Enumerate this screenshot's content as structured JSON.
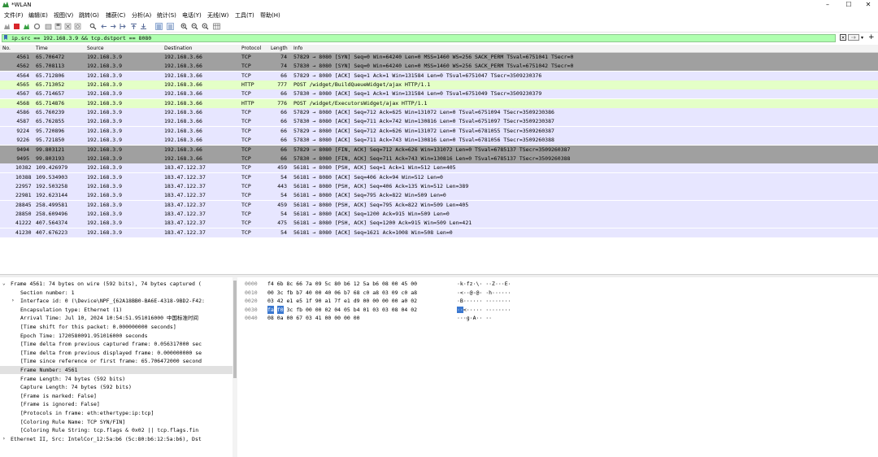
{
  "window": {
    "title": "*WLAN",
    "controls": [
      "–",
      "☐",
      "✕"
    ]
  },
  "menu": [
    "文件(F)",
    "编辑(E)",
    "视图(V)",
    "跳转(G)",
    "捕获(C)",
    "分析(A)",
    "统计(S)",
    "电话(Y)",
    "无线(W)",
    "工具(T)",
    "帮助(H)"
  ],
  "toolbar": {
    "icons": [
      "shark-fin-icon",
      "stop-icon",
      "restart-icon",
      "options-icon",
      "open-icon",
      "save-icon",
      "close-file-icon",
      "reload-icon",
      "find-icon",
      "back-icon",
      "forward-icon",
      "goto-icon",
      "first-icon",
      "last-icon",
      "autoscroll-icon",
      "colorize-icon",
      "zoom-in-icon",
      "zoom-out-icon",
      "zoom-normal-icon",
      "resize-columns-icon"
    ]
  },
  "filter": {
    "value": "ip.src == 192.168.3.9 && tcp.dstport == 8080",
    "add_symbol": "+"
  },
  "packet_list": {
    "columns": [
      "No.",
      "Time",
      "Source",
      "Destination",
      "Protocol",
      "Length",
      "Info"
    ],
    "rows": [
      {
        "no": "4561",
        "time": "65.706472",
        "src": "192.168.3.9",
        "dst": "192.168.3.66",
        "proto": "TCP",
        "len": "74",
        "info": "57829 → 8080 [SYN] Seq=0 Win=64240 Len=0 MSS=1460 WS=256 SACK_PERM TSval=6751041 TSecr=0",
        "style": "gray"
      },
      {
        "no": "4562",
        "time": "65.708113",
        "src": "192.168.3.9",
        "dst": "192.168.3.66",
        "proto": "TCP",
        "len": "74",
        "info": "57830 → 8080 [SYN] Seq=0 Win=64240 Len=0 MSS=1460 WS=256 SACK_PERM TSval=6751042 TSecr=0",
        "style": "gray"
      },
      {
        "no": "4564",
        "time": "65.712806",
        "src": "192.168.3.9",
        "dst": "192.168.3.66",
        "proto": "TCP",
        "len": "66",
        "info": "57829 → 8080 [ACK] Seq=1 Ack=1 Win=131584 Len=0 TSval=6751047 TSecr=3509230376",
        "style": "tcp"
      },
      {
        "no": "4565",
        "time": "65.713052",
        "src": "192.168.3.9",
        "dst": "192.168.3.66",
        "proto": "HTTP",
        "len": "777",
        "info": "POST /widget/BuildQueueWidget/ajax HTTP/1.1",
        "style": "http"
      },
      {
        "no": "4567",
        "time": "65.714657",
        "src": "192.168.3.9",
        "dst": "192.168.3.66",
        "proto": "TCP",
        "len": "66",
        "info": "57830 → 8080 [ACK] Seq=1 Ack=1 Win=131584 Len=0 TSval=6751049 TSecr=3509230379",
        "style": "tcp"
      },
      {
        "no": "4568",
        "time": "65.714876",
        "src": "192.168.3.9",
        "dst": "192.168.3.66",
        "proto": "HTTP",
        "len": "776",
        "info": "POST /widget/ExecutorsWidget/ajax HTTP/1.1",
        "style": "http"
      },
      {
        "no": "4586",
        "time": "65.760239",
        "src": "192.168.3.9",
        "dst": "192.168.3.66",
        "proto": "TCP",
        "len": "66",
        "info": "57829 → 8080 [ACK] Seq=712 Ack=625 Win=131072 Len=0 TSval=6751094 TSecr=3509230386",
        "style": "tcp"
      },
      {
        "no": "4587",
        "time": "65.762855",
        "src": "192.168.3.9",
        "dst": "192.168.3.66",
        "proto": "TCP",
        "len": "66",
        "info": "57830 → 8080 [ACK] Seq=711 Ack=742 Win=130816 Len=0 TSval=6751097 TSecr=3509230387",
        "style": "tcp"
      },
      {
        "no": "9224",
        "time": "95.720896",
        "src": "192.168.3.9",
        "dst": "192.168.3.66",
        "proto": "TCP",
        "len": "66",
        "info": "57829 → 8080 [ACK] Seq=712 Ack=626 Win=131072 Len=0 TSval=6781055 TSecr=3509260387",
        "style": "tcp"
      },
      {
        "no": "9226",
        "time": "95.721850",
        "src": "192.168.3.9",
        "dst": "192.168.3.66",
        "proto": "TCP",
        "len": "66",
        "info": "57830 → 8080 [ACK] Seq=711 Ack=743 Win=130816 Len=0 TSval=6781056 TSecr=3509260388",
        "style": "tcp"
      },
      {
        "no": "9494",
        "time": "99.803121",
        "src": "192.168.3.9",
        "dst": "192.168.3.66",
        "proto": "TCP",
        "len": "66",
        "info": "57829 → 8080 [FIN, ACK] Seq=712 Ack=626 Win=131072 Len=0 TSval=6785137 TSecr=3509260387",
        "style": "gray"
      },
      {
        "no": "9495",
        "time": "99.803193",
        "src": "192.168.3.9",
        "dst": "192.168.3.66",
        "proto": "TCP",
        "len": "66",
        "info": "57830 → 8080 [FIN, ACK] Seq=711 Ack=743 Win=130816 Len=0 TSval=6785137 TSecr=3509260388",
        "style": "gray"
      },
      {
        "no": "10382",
        "time": "109.426979",
        "src": "192.168.3.9",
        "dst": "183.47.122.37",
        "proto": "TCP",
        "len": "459",
        "info": "56181 → 8080 [PSH, ACK] Seq=1 Ack=1 Win=512 Len=405",
        "style": "tcp"
      },
      {
        "no": "10388",
        "time": "109.534903",
        "src": "192.168.3.9",
        "dst": "183.47.122.37",
        "proto": "TCP",
        "len": "54",
        "info": "56181 → 8080 [ACK] Seq=406 Ack=94 Win=512 Len=0",
        "style": "tcp"
      },
      {
        "no": "22957",
        "time": "192.503258",
        "src": "192.168.3.9",
        "dst": "183.47.122.37",
        "proto": "TCP",
        "len": "443",
        "info": "56181 → 8080 [PSH, ACK] Seq=406 Ack=135 Win=512 Len=389",
        "style": "tcp"
      },
      {
        "no": "22981",
        "time": "192.623144",
        "src": "192.168.3.9",
        "dst": "183.47.122.37",
        "proto": "TCP",
        "len": "54",
        "info": "56181 → 8080 [ACK] Seq=795 Ack=822 Win=509 Len=0",
        "style": "tcp"
      },
      {
        "no": "28845",
        "time": "258.499581",
        "src": "192.168.3.9",
        "dst": "183.47.122.37",
        "proto": "TCP",
        "len": "459",
        "info": "56181 → 8080 [PSH, ACK] Seq=795 Ack=822 Win=509 Len=405",
        "style": "tcp"
      },
      {
        "no": "28850",
        "time": "258.609496",
        "src": "192.168.3.9",
        "dst": "183.47.122.37",
        "proto": "TCP",
        "len": "54",
        "info": "56181 → 8080 [ACK] Seq=1200 Ack=915 Win=509 Len=0",
        "style": "tcp"
      },
      {
        "no": "41222",
        "time": "407.564374",
        "src": "192.168.3.9",
        "dst": "183.47.122.37",
        "proto": "TCP",
        "len": "475",
        "info": "56181 → 8080 [PSH, ACK] Seq=1200 Ack=915 Win=509 Len=421",
        "style": "tcp"
      },
      {
        "no": "41230",
        "time": "407.676223",
        "src": "192.168.3.9",
        "dst": "183.47.122.37",
        "proto": "TCP",
        "len": "54",
        "info": "56181 → 8080 [ACK] Seq=1621 Ack=1008 Win=508 Len=0",
        "style": "tcp"
      }
    ]
  },
  "details": [
    {
      "indent": 0,
      "arrow": "open",
      "text": "Frame 4561: 74 bytes on wire (592 bits), 74 bytes captured (",
      "selected": false
    },
    {
      "indent": 1,
      "arrow": "",
      "text": "Section number: 1",
      "selected": false
    },
    {
      "indent": 1,
      "arrow": "closed",
      "text": "Interface id: 0 (\\Device\\NPF_{62A18BB0-BA6E-4318-9BD2-F42:",
      "selected": false
    },
    {
      "indent": 1,
      "arrow": "",
      "text": "Encapsulation type: Ethernet (1)",
      "selected": false
    },
    {
      "indent": 1,
      "arrow": "",
      "text": "Arrival Time: Jul 10, 2024 10:54:51.951016000 中国标准时间",
      "selected": false
    },
    {
      "indent": 1,
      "arrow": "",
      "text": "[Time shift for this packet: 0.000000000 seconds]",
      "selected": false
    },
    {
      "indent": 1,
      "arrow": "",
      "text": "Epoch Time: 1720580091.951016000 seconds",
      "selected": false
    },
    {
      "indent": 1,
      "arrow": "",
      "text": "[Time delta from previous captured frame: 0.056317000 sec",
      "selected": false
    },
    {
      "indent": 1,
      "arrow": "",
      "text": "[Time delta from previous displayed frame: 0.000000000 se",
      "selected": false
    },
    {
      "indent": 1,
      "arrow": "",
      "text": "[Time since reference or first frame: 65.706472000 second",
      "selected": false
    },
    {
      "indent": 1,
      "arrow": "",
      "text": "Frame Number: 4561",
      "selected": true
    },
    {
      "indent": 1,
      "arrow": "",
      "text": "Frame Length: 74 bytes (592 bits)",
      "selected": false
    },
    {
      "indent": 1,
      "arrow": "",
      "text": "Capture Length: 74 bytes (592 bits)",
      "selected": false
    },
    {
      "indent": 1,
      "arrow": "",
      "text": "[Frame is marked: False]",
      "selected": false
    },
    {
      "indent": 1,
      "arrow": "",
      "text": "[Frame is ignored: False]",
      "selected": false
    },
    {
      "indent": 1,
      "arrow": "",
      "text": "[Protocols in frame: eth:ethertype:ip:tcp]",
      "selected": false
    },
    {
      "indent": 1,
      "arrow": "",
      "text": "[Coloring Rule Name: TCP SYN/FIN]",
      "selected": false
    },
    {
      "indent": 1,
      "arrow": "",
      "text": "[Coloring Rule String: tcp.flags & 0x02 || tcp.flags.fin ",
      "selected": false
    },
    {
      "indent": 0,
      "arrow": "closed",
      "text": "Ethernet II, Src: IntelCor_12:5a:b6 (5c:80:b6:12:5a:b6), Dst",
      "selected": false
    }
  ],
  "bytes": [
    {
      "offset": "0000",
      "hex": [
        "f4",
        "6b",
        "8c",
        "66",
        "7a",
        "09",
        "5c",
        "80",
        "b6",
        "12",
        "5a",
        "b6",
        "08",
        "00",
        "45",
        "00"
      ],
      "ascii": "·k·fz·\\· ··Z···E·",
      "hl_hex": [],
      "hl_ascii": ""
    },
    {
      "offset": "0010",
      "hex": [
        "00",
        "3c",
        "fb",
        "b7",
        "40",
        "00",
        "40",
        "06",
        "b7",
        "68",
        "c0",
        "a8",
        "03",
        "09",
        "c0",
        "a8"
      ],
      "ascii": "·<··@·@· ·h······",
      "hl_hex": [],
      "hl_ascii": ""
    },
    {
      "offset": "0020",
      "hex": [
        "03",
        "42",
        "e1",
        "e5",
        "1f",
        "90",
        "a1",
        "7f",
        "e1",
        "d9",
        "00",
        "00",
        "00",
        "00",
        "a0",
        "02"
      ],
      "ascii": "·B······ ········",
      "hl_hex": [],
      "hl_ascii": ""
    },
    {
      "offset": "0030",
      "hex": [
        "fa",
        "f0",
        "3c",
        "fb",
        "00",
        "00",
        "02",
        "04",
        "05",
        "b4",
        "01",
        "03",
        "03",
        "08",
        "04",
        "02"
      ],
      "ascii": "··<····· ········",
      "hl_hex": [
        0,
        1
      ],
      "hl_ascii": "··"
    },
    {
      "offset": "0040",
      "hex": [
        "08",
        "0a",
        "00",
        "67",
        "03",
        "41",
        "00",
        "00",
        "00",
        "00"
      ],
      "ascii": "···g·A·· ··",
      "hl_hex": [],
      "hl_ascii": ""
    }
  ]
}
